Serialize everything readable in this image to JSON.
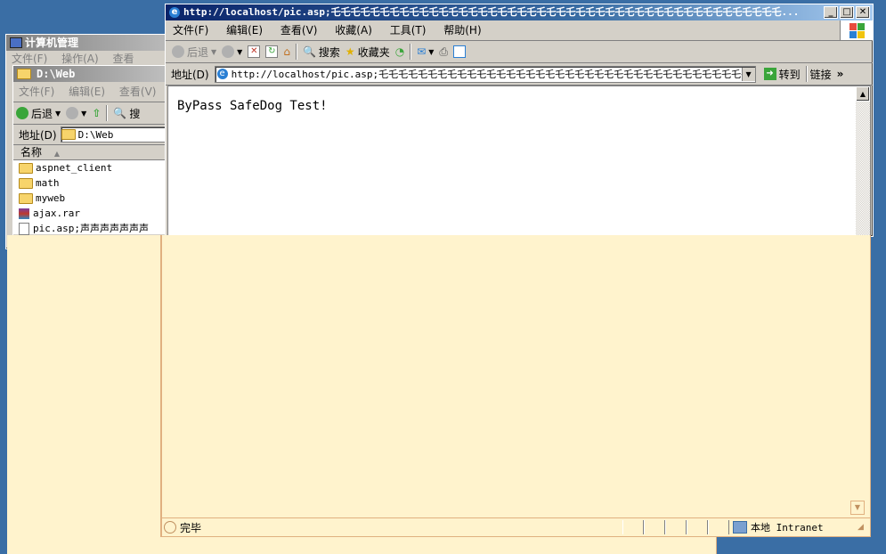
{
  "computer_mgmt": {
    "title": "计算机管理",
    "menu": [
      "文件(F)",
      "操作(A)",
      "查看"
    ]
  },
  "explorer": {
    "title": "D:\\Web",
    "menu": [
      "文件(F)",
      "编辑(E)",
      "查看(V)"
    ],
    "back_label": "后退",
    "search_label": "搜",
    "address_label": "地址(D)",
    "address_value": "D:\\Web",
    "column_name": "名称",
    "files": [
      {
        "name": "aspnet_client",
        "type": "folder"
      },
      {
        "name": "math",
        "type": "folder"
      },
      {
        "name": "myweb",
        "type": "folder"
      },
      {
        "name": "ajax.rar",
        "type": "rar"
      },
      {
        "name": "pic.asp;声声声声声声声",
        "type": "asp"
      }
    ]
  },
  "ie": {
    "title": "http://localhost/pic.asp;乇乇乇乇乇乇乇乇乇乇乇乇乇乇乇乇乇乇乇乇乇乇乇乇乇乇乇乇乇乇乇乇乇乇乇乇乇乇乇乇乇乇乇乇乇乇...",
    "menu": [
      "文件(F)",
      "编辑(E)",
      "查看(V)",
      "收藏(A)",
      "工具(T)",
      "帮助(H)"
    ],
    "toolbar": {
      "back": "后退",
      "search": "搜索",
      "favorites": "收藏夹"
    },
    "address_label": "地址(D)",
    "address_value": "http://localhost/pic.asp;乇乇乇乇乇乇乇乇乇乇乇乇乇乇乇乇乇乇乇乇乇乇乇乇乇乇乇乇乇乇乇乇乇乇乇乇乇乇乇",
    "go_label": "转到",
    "links_label": "链接",
    "content_text": "ByPass SafeDog Test!",
    "status_text": "完毕",
    "zone_text": "本地 Intranet"
  },
  "colors": {
    "desktop": "#3a6ea5",
    "overlay": "#fff3cd",
    "title_active": "#0a246a"
  }
}
